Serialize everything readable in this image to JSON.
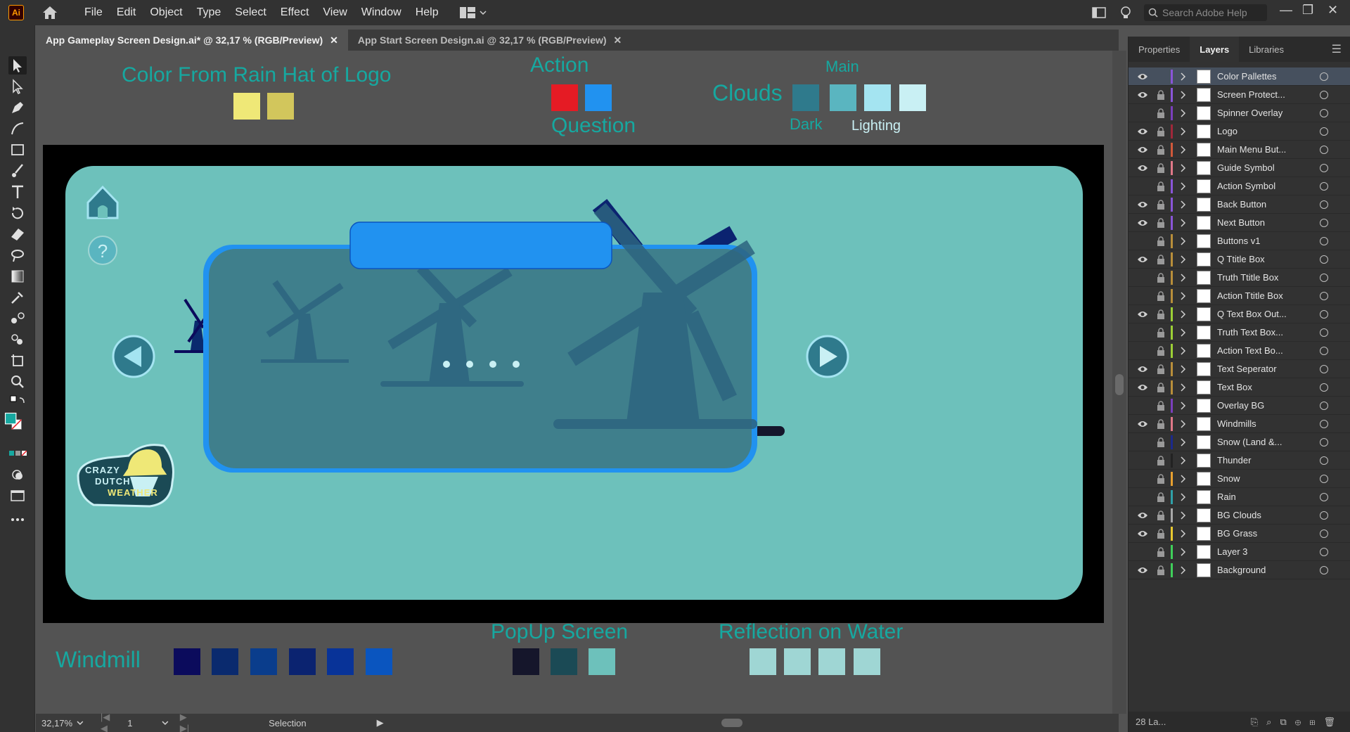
{
  "app": {
    "logo_text": "Ai"
  },
  "menu": [
    "File",
    "Edit",
    "Object",
    "Type",
    "Select",
    "Effect",
    "View",
    "Window",
    "Help"
  ],
  "search": {
    "placeholder": "Search Adobe Help"
  },
  "doc_tabs": [
    {
      "label": "App Gameplay Screen Design.ai* @ 32,17 % (RGB/Preview)",
      "close": "✕"
    },
    {
      "label": "App Start Screen Design.ai @ 32,17 % (RGB/Preview)",
      "close": "✕"
    }
  ],
  "canvas_labels": {
    "rain_hat": "Color From Rain Hat of Logo",
    "action": "Action",
    "question": "Question",
    "main": "Main",
    "clouds": "Clouds",
    "dark": "Dark",
    "lighting": "Lighting",
    "windmill": "Windmill",
    "popup": "PopUp Screen",
    "reflection": "Reflection on Water"
  },
  "swatches": {
    "rain_hat": [
      "#efe877",
      "#d2c65c"
    ],
    "action_question": [
      "#e51b24",
      "#2192f0"
    ],
    "clouds": [
      "#2f7a8c",
      "#5ab5c0",
      "#a4e4f1",
      "#c9f0f4"
    ],
    "windmill": [
      "#0b0b5c",
      "#0a2a6e",
      "#0a3d8c",
      "#0b2370",
      "#083398",
      "#0a55bf"
    ],
    "popup": [
      "#15162b",
      "#1b4a55",
      "#6dc1bb"
    ],
    "reflection": [
      "#9fd6d4",
      "#9fd6d4",
      "#9fd6d4",
      "#9fd6d4"
    ]
  },
  "logo_text": {
    "line1": "CRAZY",
    "line2": "DUTCH",
    "line3": "WEATHER"
  },
  "status": {
    "zoom": "32,17%",
    "page": "1",
    "tool": "Selection"
  },
  "panel": {
    "tabs": [
      "Properties",
      "Layers",
      "Libraries"
    ],
    "footer": "28 La..."
  },
  "layers": [
    {
      "name": "Color Pallettes",
      "visible": true,
      "locked": false,
      "color": "#8a55d8",
      "selected": true
    },
    {
      "name": "Screen Protect...",
      "visible": true,
      "locked": true,
      "color": "#8a55d8"
    },
    {
      "name": "Spinner Overlay",
      "visible": false,
      "locked": true,
      "color": "#7b3fbd"
    },
    {
      "name": "Logo",
      "visible": true,
      "locked": true,
      "color": "#a0283a"
    },
    {
      "name": "Main Menu But...",
      "visible": true,
      "locked": true,
      "color": "#d0583a"
    },
    {
      "name": "Guide Symbol",
      "visible": true,
      "locked": true,
      "color": "#e07888"
    },
    {
      "name": "Action Symbol",
      "visible": false,
      "locked": true,
      "color": "#8a55d8"
    },
    {
      "name": "Back Button",
      "visible": true,
      "locked": true,
      "color": "#8a55d8"
    },
    {
      "name": "Next Button",
      "visible": true,
      "locked": true,
      "color": "#8a55d8"
    },
    {
      "name": "Buttons v1",
      "visible": false,
      "locked": true,
      "color": "#b88e3a"
    },
    {
      "name": "Q Ttitle Box",
      "visible": true,
      "locked": true,
      "color": "#b88e3a"
    },
    {
      "name": "Truth Ttitle Box",
      "visible": false,
      "locked": true,
      "color": "#b88e3a"
    },
    {
      "name": "Action Ttitle Box",
      "visible": false,
      "locked": true,
      "color": "#b88e3a"
    },
    {
      "name": "Q Text Box Out...",
      "visible": true,
      "locked": true,
      "color": "#9ccf36"
    },
    {
      "name": "Truth Text Box...",
      "visible": false,
      "locked": true,
      "color": "#9ccf36"
    },
    {
      "name": "Action Text Bo...",
      "visible": false,
      "locked": true,
      "color": "#9ccf36"
    },
    {
      "name": "Text Seperator",
      "visible": true,
      "locked": true,
      "color": "#b88e3a"
    },
    {
      "name": "Text Box",
      "visible": true,
      "locked": true,
      "color": "#b88e3a"
    },
    {
      "name": "Overlay BG",
      "visible": false,
      "locked": true,
      "color": "#7b3fbd"
    },
    {
      "name": "Windmills",
      "visible": true,
      "locked": true,
      "color": "#e07888"
    },
    {
      "name": "Snow (Land &...",
      "visible": false,
      "locked": true,
      "color": "#1c2a8c"
    },
    {
      "name": "Thunder",
      "visible": false,
      "locked": true,
      "color": "#222222"
    },
    {
      "name": "Snow",
      "visible": false,
      "locked": true,
      "color": "#e8a030"
    },
    {
      "name": "Rain",
      "visible": false,
      "locked": true,
      "color": "#2fa0a8"
    },
    {
      "name": "BG Clouds",
      "visible": true,
      "locked": true,
      "color": "#a8a8a8"
    },
    {
      "name": "BG Grass",
      "visible": true,
      "locked": true,
      "color": "#e8c830"
    },
    {
      "name": "Layer 3",
      "visible": false,
      "locked": true,
      "color": "#3fcf5a"
    },
    {
      "name": "Background",
      "visible": true,
      "locked": true,
      "color": "#3fcf5a"
    }
  ]
}
